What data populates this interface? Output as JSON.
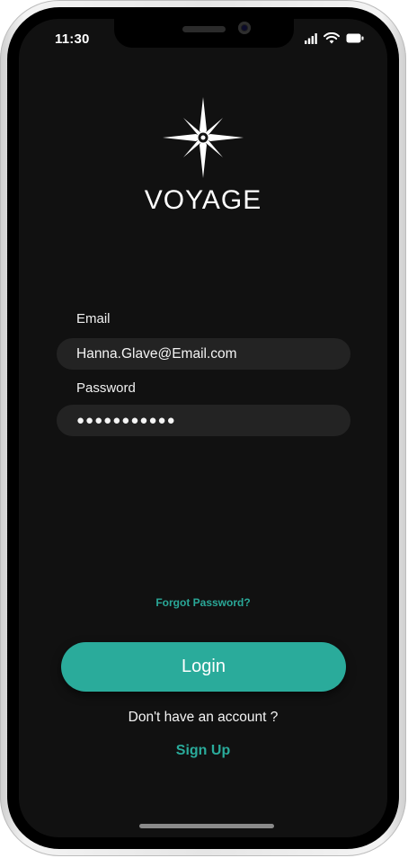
{
  "status_bar": {
    "time": "11:30",
    "icons": [
      "signal-icon",
      "wifi-icon",
      "battery-icon"
    ]
  },
  "brand": {
    "name": "VOYAGE",
    "logo_icon": "compass-star-icon"
  },
  "form": {
    "email_label": "Email",
    "email_value": "Hanna.Glave@Email.com",
    "password_label": "Password",
    "password_value": "●●●●●●●●●●●"
  },
  "actions": {
    "forgot_password": "Forgot Password?",
    "login_label": "Login",
    "no_account_text": "Don't have an account ?",
    "signup_label": "Sign Up"
  },
  "colors": {
    "accent": "#2aab9b",
    "screen_background": "#111111",
    "field_background": "#232323",
    "text": "#ffffff"
  }
}
